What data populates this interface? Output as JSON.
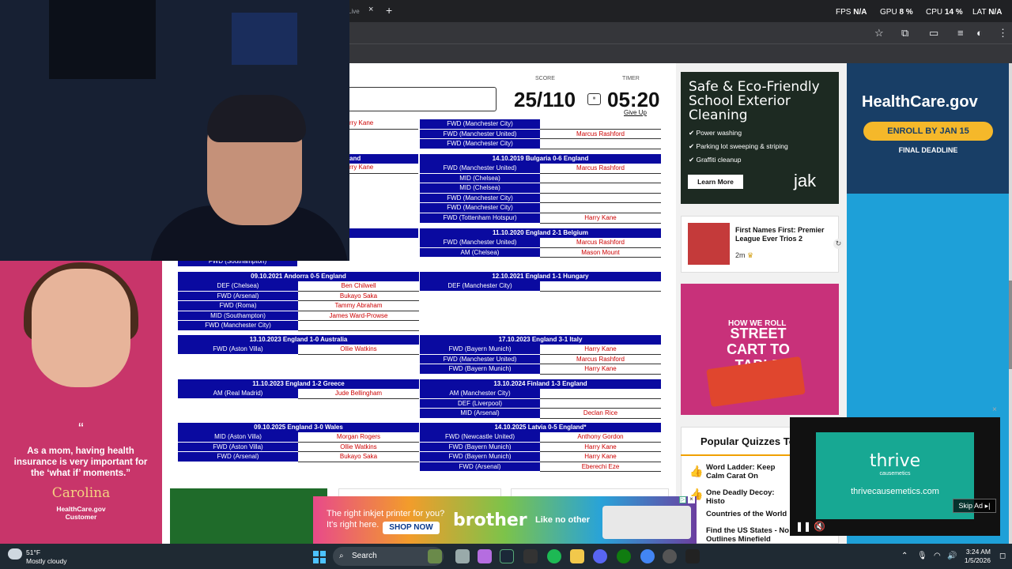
{
  "browser": {
    "tab_label": "Live",
    "tab_close": "×",
    "new_tab": "+",
    "perf": [
      {
        "label": "FPS",
        "value": "N/A"
      },
      {
        "label": "GPU",
        "value": "8 %"
      },
      {
        "label": "CPU",
        "value": "14 %"
      },
      {
        "label": "LAT",
        "value": "N/A"
      }
    ]
  },
  "quiz": {
    "score_label": "SCORE",
    "timer_label": "TIMER",
    "score": "25/110",
    "timer": "05:20",
    "pause_icon": "⏸",
    "give_up": "Give Up",
    "left_fragments": [
      "rry Kane",
      "and",
      "rry Kane",
      "FWD (Southampton)"
    ],
    "tables": [
      {
        "title": "",
        "rows": [
          {
            "pos": "FWD (Manchester City)",
            "ans": ""
          },
          {
            "pos": "FWD (Manchester United)",
            "ans": "Marcus Rashford"
          },
          {
            "pos": "FWD (Manchester City)",
            "ans": ""
          }
        ]
      },
      {
        "title": "14.10.2019 Bulgaria 0-6 England",
        "rows": [
          {
            "pos": "FWD (Manchester United)",
            "ans": "Marcus Rashford"
          },
          {
            "pos": "MID (Chelsea)",
            "ans": ""
          },
          {
            "pos": "MID (Chelsea)",
            "ans": ""
          },
          {
            "pos": "FWD (Manchester City)",
            "ans": ""
          },
          {
            "pos": "FWD (Manchester City)",
            "ans": ""
          },
          {
            "pos": "FWD (Tottenham Hotspur)",
            "ans": "Harry Kane"
          }
        ]
      },
      {
        "title": "11.10.2020 England 2-1 Belgium",
        "rows": [
          {
            "pos": "FWD (Manchester United)",
            "ans": "Marcus Rashford"
          },
          {
            "pos": "AM (Chelsea)",
            "ans": "Mason Mount"
          }
        ]
      },
      {
        "title": "09.10.2021 Andorra 0-5 England",
        "rows": [
          {
            "pos": "DEF (Chelsea)",
            "ans": "Ben Chilwell"
          },
          {
            "pos": "FWD (Arsenal)",
            "ans": "Bukayo Saka"
          },
          {
            "pos": "FWD (Roma)",
            "ans": "Tammy Abraham"
          },
          {
            "pos": "MID (Southampton)",
            "ans": "James Ward-Prowse"
          },
          {
            "pos": "FWD (Manchester City)",
            "ans": ""
          }
        ]
      },
      {
        "title": "12.10.2021 England 1-1 Hungary",
        "rows": [
          {
            "pos": "DEF (Manchester City)",
            "ans": ""
          }
        ]
      },
      {
        "title": "13.10.2023 England 1-0 Australia",
        "rows": [
          {
            "pos": "FWD (Aston Villa)",
            "ans": "Ollie Watkins"
          }
        ]
      },
      {
        "title": "17.10.2023 England 3-1 Italy",
        "rows": [
          {
            "pos": "FWD (Bayern Munich)",
            "ans": "Harry Kane"
          },
          {
            "pos": "FWD (Manchester United)",
            "ans": "Marcus Rashford"
          },
          {
            "pos": "FWD (Bayern Munich)",
            "ans": "Harry Kane"
          }
        ]
      },
      {
        "title": "11.10.2023 England 1-2 Greece",
        "rows": [
          {
            "pos": "AM (Real Madrid)",
            "ans": "Jude Bellingham"
          }
        ]
      },
      {
        "title": "13.10.2024 Finland 1-3 England",
        "rows": [
          {
            "pos": "AM (Manchester City)",
            "ans": ""
          },
          {
            "pos": "DEF (Liverpool)",
            "ans": ""
          },
          {
            "pos": "MID (Arsenal)",
            "ans": "Declan Rice"
          }
        ]
      },
      {
        "title": "09.10.2025 England 3-0 Wales",
        "rows": [
          {
            "pos": "MID (Aston Villa)",
            "ans": "Morgan Rogers"
          },
          {
            "pos": "FWD (Aston Villa)",
            "ans": "Ollie Watkins"
          },
          {
            "pos": "FWD (Arsenal)",
            "ans": "Bukayo Saka"
          }
        ]
      },
      {
        "title": "14.10.2025 Latvia 0-5 England*",
        "rows": [
          {
            "pos": "FWD (Newcastle United)",
            "ans": "Anthony Gordon"
          },
          {
            "pos": "FWD (Bayern Munich)",
            "ans": "Harry Kane"
          },
          {
            "pos": "FWD (Bayern Munich)",
            "ans": "Harry Kane"
          },
          {
            "pos": "FWD (Arsenal)",
            "ans": "Eberechi Eze"
          }
        ]
      }
    ]
  },
  "ads": {
    "eco_title": "Safe & Eco-Friendly School Exterior Cleaning",
    "eco_items": [
      "Power washing",
      "Parking lot sweeping & striping",
      "Graffiti cleanup"
    ],
    "eco_button": "Learn More",
    "eco_brand": "jak",
    "quiz_card_title": "First Names First: Premier League Ever Trios 2",
    "quiz_card_time": "2m",
    "kroger_line1": "HOW WE ROLL",
    "kroger_line2": "STREET CART TO TABLE",
    "healthcare_logo": "HealthCare.gov",
    "healthcare_enroll": "ENROLL BY JAN 15",
    "healthcare_deadline": "FINAL DEADLINE",
    "popular_title": "Popular Quizzes To",
    "popular_items": [
      "Word Ladder: Keep Calm Carat On",
      "One Deadly Decoy: Histo",
      "Countries of the World",
      "Find the US States - No Outlines Minefield"
    ],
    "left_quote": "As a mom, having health insurance is very important for the ‘what if’ moments.”",
    "left_name": "Carolina",
    "left_sub1": "HealthCare.gov",
    "left_sub2": "Customer",
    "brother_text1": "The right inkjet printer for you?",
    "brother_text2": "It's right here.",
    "brother_shop": "SHOP NOW",
    "brother_logo": "brother",
    "brother_tag": "Like no other",
    "thrive_logo": "thrive",
    "thrive_sub": "causemetics",
    "thrive_url": "thrivecausemetics.com",
    "skip_ad": "Skip Ad ▸|"
  },
  "taskbar": {
    "temp": "51°F",
    "weather": "Mostly cloudy",
    "search": "Search",
    "time": "3:24 AM",
    "date": "1/5/2026"
  }
}
